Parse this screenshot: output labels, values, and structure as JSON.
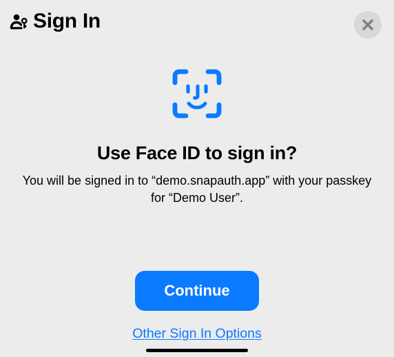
{
  "header": {
    "title": "Sign In"
  },
  "prompt": {
    "headline": "Use Face ID to sign in?",
    "description": "You will be signed in to “demo.snapauth.app” with your passkey for “Demo User”."
  },
  "actions": {
    "continue_label": "Continue",
    "other_label": "Other Sign In Options"
  },
  "colors": {
    "accent": "#0a7aff"
  }
}
